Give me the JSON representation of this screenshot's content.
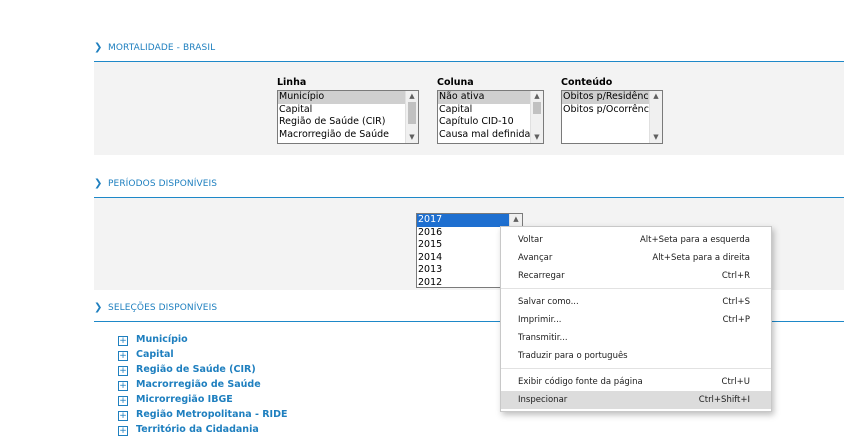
{
  "sections": {
    "mortalidade": "MORTALIDADE - BRASIL",
    "periodos": "PERÍODOS DISPONÍVEIS",
    "selecoes": "SELEÇÕES DISPONÍVEIS"
  },
  "linha": {
    "label": "Linha",
    "options": [
      "Município",
      "Capital",
      "Região de Saúde (CIR)",
      "Macrorregião de Saúde"
    ],
    "selected": "Município"
  },
  "coluna": {
    "label": "Coluna",
    "options": [
      "Não ativa",
      "Capital",
      "Capítulo CID-10",
      "Causa mal definidas"
    ],
    "selected": "Não ativa"
  },
  "conteudo": {
    "label": "Conteúdo",
    "options": [
      "Óbitos p/Residênc",
      "Óbitos p/Ocorrênc"
    ],
    "selected": "Óbitos p/Residênc"
  },
  "periodos": {
    "options": [
      "2017",
      "2016",
      "2015",
      "2014",
      "2013",
      "2012"
    ],
    "selected": "2017"
  },
  "selecoes": {
    "items": [
      "Município",
      "Capital",
      "Região de Saúde (CIR)",
      "Macrorregião de Saúde",
      "Microrregião IBGE",
      "Região Metropolitana - RIDE",
      "Território da Cidadania"
    ],
    "expand_symbol": "+"
  },
  "context_menu": {
    "items": [
      {
        "label": "Voltar",
        "shortcut": "Alt+Seta para a esquerda"
      },
      {
        "label": "Avançar",
        "shortcut": "Alt+Seta para a direita"
      },
      {
        "label": "Recarregar",
        "shortcut": "Ctrl+R"
      },
      {
        "label": "Salvar como...",
        "shortcut": "Ctrl+S"
      },
      {
        "label": "Imprimir...",
        "shortcut": "Ctrl+P"
      },
      {
        "label": "Transmitir...",
        "shortcut": ""
      },
      {
        "label": "Traduzir para o português",
        "shortcut": ""
      },
      {
        "label": "Exibir código fonte da página",
        "shortcut": "Ctrl+U"
      },
      {
        "label": "Inspecionar",
        "shortcut": "Ctrl+Shift+I"
      }
    ],
    "highlighted": "Inspecionar"
  },
  "colors": {
    "accent": "#1e7fbf",
    "panel_bg": "#f3f3f3",
    "selection_blue": "#1e6fd0"
  },
  "icons": {
    "section_chevron": "chevron-right-icon",
    "tree_expand": "plus-box-icon"
  }
}
